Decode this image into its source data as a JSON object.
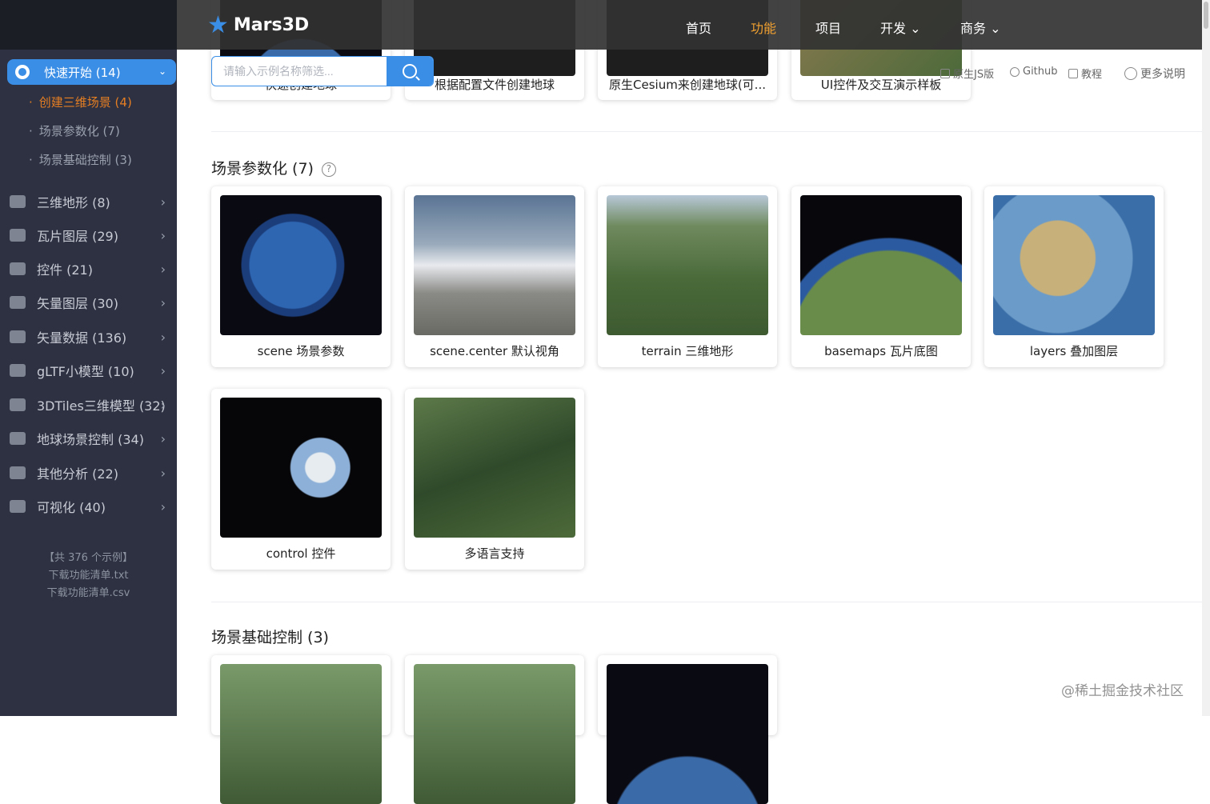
{
  "topbar": {
    "brand": "Mars3D",
    "nav": [
      {
        "label": "首页",
        "active": false
      },
      {
        "label": "功能",
        "active": true
      },
      {
        "label": "项目",
        "active": false
      },
      {
        "label": "开发",
        "active": false,
        "dropdown": true
      },
      {
        "label": "商务",
        "active": false,
        "dropdown": true
      }
    ]
  },
  "search": {
    "placeholder": "请输入示例名称筛选...",
    "value": ""
  },
  "right_links": [
    "原生JS版",
    "Github",
    "教程",
    "更多说明"
  ],
  "sidebar": {
    "active": {
      "label": "快速开始 (14)"
    },
    "subs": [
      "创建三维场景 (4)",
      "场景参数化 (7)",
      "场景基础控制 (3)"
    ],
    "items": [
      {
        "label": "三维地形 (8)"
      },
      {
        "label": "瓦片图层 (29)"
      },
      {
        "label": "控件 (21)"
      },
      {
        "label": "矢量图层 (30)"
      },
      {
        "label": "矢量数据 (136)"
      },
      {
        "label": "gLTF小模型 (10)"
      },
      {
        "label": "3DTiles三维模型 (32)"
      },
      {
        "label": "地球场景控制 (34)"
      },
      {
        "label": "其他分析 (22)"
      },
      {
        "label": "可视化 (40)"
      }
    ],
    "footer": [
      "【共 376 个示例】",
      "下载功能清单.txt",
      "下载功能清单.csv"
    ]
  },
  "top_row_cards": [
    "快速创建地球",
    "根据配置文件创建地球",
    "原生Cesium来创建地球(可...",
    "UI控件及交互演示样板"
  ],
  "sections": [
    {
      "title": "场景参数化 (7)",
      "help": "?",
      "cards": [
        "scene 场景参数",
        "scene.center 默认视角",
        "terrain 三维地形",
        "basemaps 瓦片底图",
        "layers 叠加图层",
        "control 控件",
        "多语言支持"
      ]
    },
    {
      "title": "场景基础控制 (3)",
      "cards": []
    }
  ],
  "watermark": "@稀土掘金技术社区",
  "icons": [
    "globe-icon",
    "chevron-down-icon",
    "chevron-right-icon",
    "search-icon",
    "github-icon",
    "book-icon",
    "question-icon"
  ],
  "colors": {
    "accent": "#3a8ee6",
    "active_nav": "#f0a030",
    "sidebar_bg": "#2d3142",
    "sub_current": "#e67e22"
  }
}
